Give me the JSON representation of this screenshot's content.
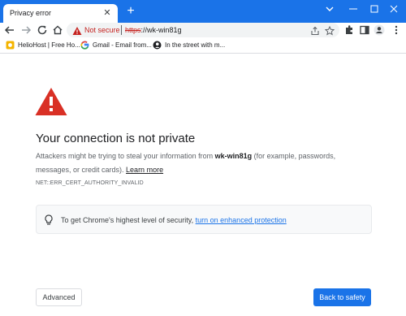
{
  "tab": {
    "title": "Privacy error",
    "close_glyph": "✕",
    "new_tab_glyph": "+"
  },
  "window_controls": {
    "menu_glyph": "⌄",
    "minimize_glyph": "—",
    "maximize_glyph": "☐",
    "close_glyph": "✕"
  },
  "omnibox": {
    "security_label": "Not secure",
    "url_scheme": "https",
    "url_rest": "://wk-win81g"
  },
  "bookmarks": [
    {
      "label": "HelioHost | Free Ho...",
      "icon": "heliohost-icon"
    },
    {
      "label": "Gmail - Email from...",
      "icon": "google-icon"
    },
    {
      "label": "In the street with m...",
      "icon": "profile-silhouette-icon"
    }
  ],
  "page": {
    "heading": "Your connection is not private",
    "body_prefix": "Attackers might be trying to steal your information from ",
    "host": "wk-win81g",
    "body_suffix": " (for example, passwords, messages, or credit cards). ",
    "learn_more": "Learn more",
    "error_code": "NET::ERR_CERT_AUTHORITY_INVALID",
    "tip_prefix": "To get Chrome's highest level of security, ",
    "tip_link": "turn on enhanced protection",
    "advanced_button": "Advanced",
    "safety_button": "Back to safety"
  },
  "colors": {
    "accent": "#1a73e8",
    "danger": "#c5221f",
    "warning_triangle": "#d93025"
  }
}
